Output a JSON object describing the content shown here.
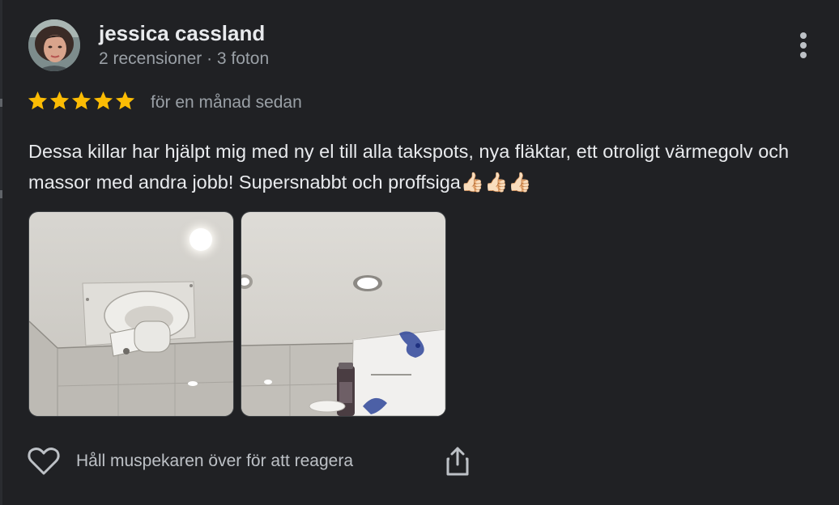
{
  "review": {
    "author": {
      "name": "jessica cassland",
      "meta": "2 recensioner · 3 foton"
    },
    "rating": {
      "value": 5,
      "max": 5,
      "star_color": "#fbbc04"
    },
    "time_ago": "för en månad sedan",
    "text": "Dessa killar har hjälpt mig med ny el till alla takspots, nya fläktar, ett otroligt värmegolv och massor med andra jobb! Supersnabbt och proffsiga👍🏻👍🏻👍🏻",
    "photos": [
      {
        "icon": "bathroom-ceiling-fan-photo"
      },
      {
        "icon": "bathroom-ceiling-spotlight-photo"
      }
    ],
    "actions": {
      "react_hint": "Håll muspekaren över för att reagera",
      "like_icon": "heart-icon",
      "share_icon": "share-icon",
      "more_icon": "more-vertical-icon"
    }
  },
  "colors": {
    "background": "#202124",
    "primary_text": "#e8eaed",
    "secondary_text": "#9aa0a6"
  }
}
